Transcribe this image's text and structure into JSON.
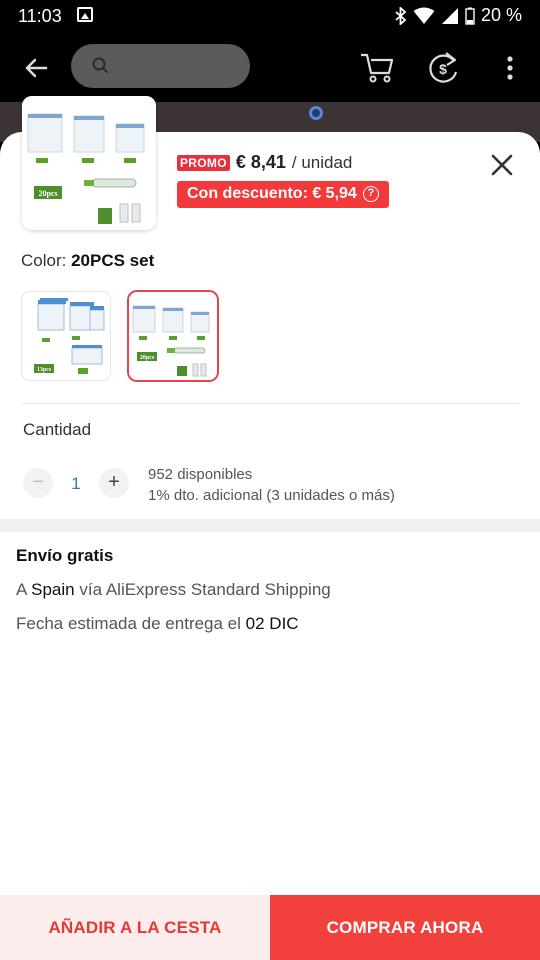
{
  "status_bar": {
    "time": "11:03",
    "battery": "20 %"
  },
  "product": {
    "promo_tag": "PROMO",
    "price": "€ 8,41",
    "price_unit": "/ unidad",
    "discount_label": "Con descuento: € 5,94",
    "discount_info": "?",
    "color_prefix": "Color:",
    "color_value": "20PCS set",
    "thumb_pack_label": "20pcs",
    "variants": [
      {
        "pack_label": "13pcs",
        "selected": false
      },
      {
        "pack_label": "20pcs",
        "selected": true
      }
    ]
  },
  "quantity": {
    "label": "Cantidad",
    "minus": "−",
    "value": "1",
    "plus": "+",
    "stock": "952 disponibles",
    "extra_discount": "1% dto. adicional (3 unidades o más)"
  },
  "shipping": {
    "title": "Envío gratis",
    "prefix": "A",
    "country": "Spain",
    "method": "vía AliExpress Standard Shipping",
    "delivery_prefix": "Fecha estimada de entrega el",
    "delivery_date": "02 DIC"
  },
  "actions": {
    "add_to_cart": "AÑADIR A LA CESTA",
    "buy_now": "COMPRAR AHORA"
  },
  "colors": {
    "accent_red": "#f2413d",
    "promo_red": "#e8313f",
    "link_blue": "#2979c9"
  }
}
